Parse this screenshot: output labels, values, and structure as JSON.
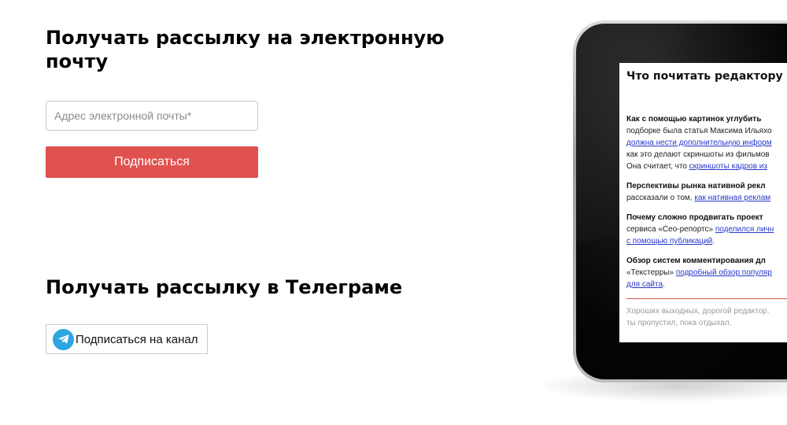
{
  "email_section": {
    "title": "Получать рассылку на электронную почту",
    "input_placeholder": "Адрес электронной почты*",
    "input_value": "",
    "button_label": "Подписаться",
    "button_color": "#e0524f"
  },
  "telegram_section": {
    "title": "Получать рассылку в Телеграме",
    "button_label": "Подписаться на канал",
    "icon": "telegram-icon",
    "icon_color": "#2ca5e0"
  },
  "tablet_preview": {
    "title": "Что почитать редактору",
    "paragraphs": [
      {
        "lines": [
          [
            {
              "t": "Как с помощью картинок углубить",
              "s": "b"
            }
          ],
          [
            {
              "t": "подборке была статья Максима Ильяхо",
              "s": "n"
            }
          ],
          [
            {
              "t": "должна нести дополнительную информ",
              "s": "l"
            }
          ],
          [
            {
              "t": "как это делают скриншоты из фильмов",
              "s": "n"
            }
          ],
          [
            {
              "t": "Она считает, что ",
              "s": "n"
            },
            {
              "t": "скриншоты кадров из",
              "s": "l"
            }
          ]
        ]
      },
      {
        "lines": [
          [
            {
              "t": "Перспективы рынка нативной рекл",
              "s": "b"
            }
          ],
          [
            {
              "t": "рассказали о том, ",
              "s": "n"
            },
            {
              "t": "как нативная реклам",
              "s": "l"
            }
          ]
        ]
      },
      {
        "lines": [
          [
            {
              "t": "Почему сложно продвигать проект",
              "s": "b"
            }
          ],
          [
            {
              "t": "сервиса «Сео-репортс» ",
              "s": "n"
            },
            {
              "t": "поделился личн",
              "s": "l"
            }
          ],
          [
            {
              "t": "с помощью публикаций",
              "s": "l"
            },
            {
              "t": ".",
              "s": "n"
            }
          ]
        ]
      },
      {
        "lines": [
          [
            {
              "t": "Обзор систем комментирования дл",
              "s": "b"
            }
          ],
          [
            {
              "t": "«Текстерры» ",
              "s": "n"
            },
            {
              "t": "подробный обзор популяр",
              "s": "l"
            }
          ],
          [
            {
              "t": "для сайта",
              "s": "l"
            },
            {
              "t": ".",
              "s": "n"
            }
          ]
        ]
      }
    ],
    "footer_lines": [
      "Хороших выходных, дорогой редактор.",
      "ты пропустил, пока отдыхал."
    ],
    "link_color": "#2637c9",
    "rule_color": "#d6504a"
  }
}
